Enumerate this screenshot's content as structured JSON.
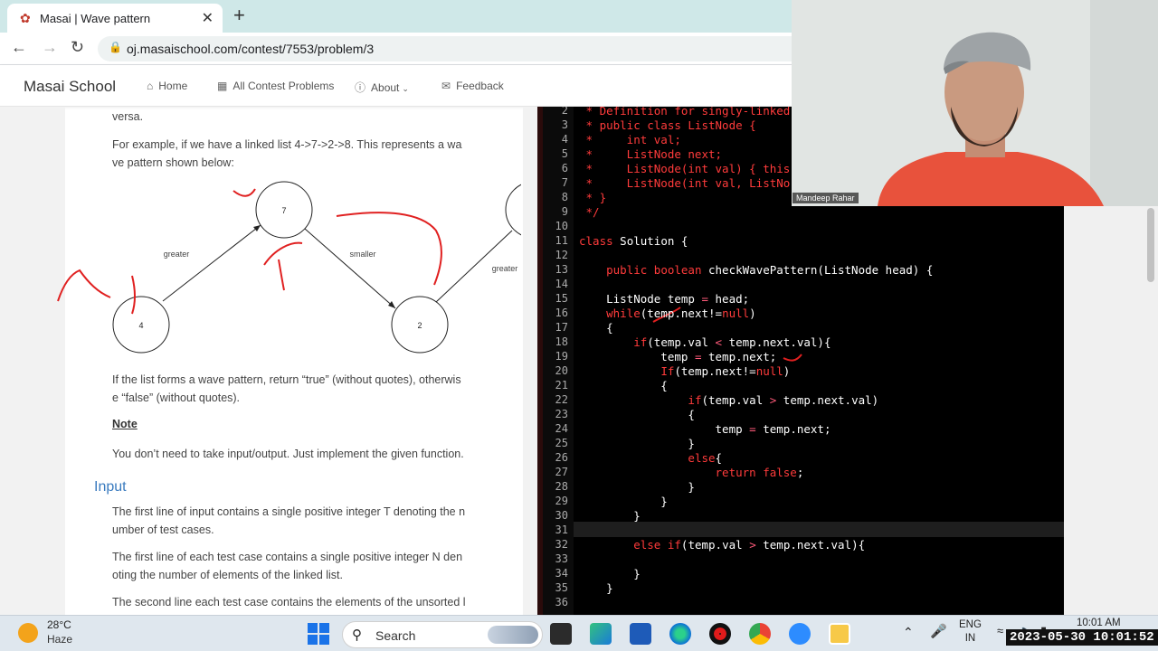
{
  "browser": {
    "tab_title": "Masai | Wave pattern",
    "url": "oj.masaischool.com/contest/7553/problem/3"
  },
  "site_nav": {
    "brand": "Masai School",
    "items": [
      {
        "label": "Home",
        "icon": "home-icon"
      },
      {
        "label": "All Contest Problems",
        "icon": "grid-icon"
      },
      {
        "label": "About",
        "icon": "info-icon"
      },
      {
        "label": "Feedback",
        "icon": "feedback-icon"
      }
    ]
  },
  "problem": {
    "p0": "versa.",
    "p1": [
      "For example, if we have a linked list 4->7->2->8. This represents a wa",
      "ve pattern shown below:"
    ],
    "diagram": {
      "nodes": [
        "4",
        "7",
        "2"
      ],
      "edge_labels": [
        "greater",
        "smaller",
        "greater"
      ]
    },
    "p2": [
      "If the list forms a wave pattern, return “true” (without quotes), otherwis",
      "e “false” (without quotes)."
    ],
    "note_heading": "Note",
    "p3": "You don’t need to take input/output. Just implement the given function.",
    "input_heading": "Input",
    "p4": [
      "The first line of input contains a single positive integer T denoting the n",
      "umber of test cases."
    ],
    "p5": [
      "The first line of each test case contains a single positive integer N den",
      "oting the number of elements of the linked list."
    ],
    "p6": "The second line each test case contains the elements of the unsorted l"
  },
  "editor": {
    "line_numbers": [
      "2",
      "3",
      "4",
      "5",
      "6",
      "7",
      "8",
      "9",
      "10",
      "11",
      "12",
      "13",
      "14",
      "15",
      "16",
      "17",
      "18",
      "19",
      "20",
      "21",
      "22",
      "23",
      "24",
      "25",
      "26",
      "27",
      "28",
      "29",
      "30",
      "31",
      "32",
      "33",
      "34",
      "35",
      "36"
    ],
    "lines": [
      " * Definition for singly-linked",
      " * public class ListNode {",
      " *     int val;",
      " *     ListNode next;",
      " *     ListNode(int val) { this",
      " *     ListNode(int val, ListNo",
      " * }",
      " */",
      "",
      "class Solution {",
      "",
      "    public boolean checkWavePattern(ListNode head) {",
      "",
      "    ListNode temp = head;",
      "    while(temp.next!=null)",
      "    {",
      "        if(temp.val < temp.next.val){",
      "            temp = temp.next;",
      "            If(temp.next!=null)",
      "            {",
      "                if(temp.val > temp.next.val)",
      "                {",
      "                    temp = temp.next;",
      "                }",
      "                else{",
      "                    return false;",
      "                }",
      "            }",
      "        }",
      "",
      "        else if(temp.val > temp.next.val){",
      "",
      "        }",
      "    }",
      ""
    ]
  },
  "webcam": {
    "name": "Mandeep Rahar"
  },
  "taskbar": {
    "temperature": "28°C",
    "condition": "Haze",
    "search_label": "Search",
    "lang_1": "ENG",
    "lang_2": "IN",
    "time": "10:01 AM"
  },
  "timestamp_overlay": "2023-05-30 10:01:52"
}
